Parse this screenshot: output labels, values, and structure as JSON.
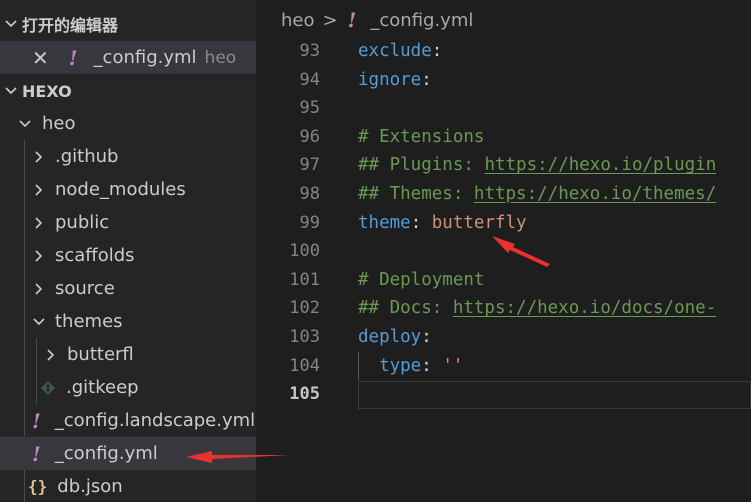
{
  "sidebar": {
    "open_editors_title": "打开的编辑器",
    "open_editor_item": {
      "name": "_config.yml",
      "description": "heo",
      "close_glyph": "✕",
      "file_glyph": "!"
    },
    "project_title": "HEXO",
    "tree": [
      {
        "label": "heo",
        "type": "folder-open"
      },
      {
        "label": ".github",
        "type": "folder"
      },
      {
        "label": "node_modules",
        "type": "folder"
      },
      {
        "label": "public",
        "type": "folder"
      },
      {
        "label": "scaffolds",
        "type": "folder"
      },
      {
        "label": "source",
        "type": "folder"
      },
      {
        "label": "themes",
        "type": "folder-open"
      },
      {
        "label": "butterfl",
        "type": "folder"
      },
      {
        "label": ".gitkeep",
        "type": "git-file"
      },
      {
        "label": "_config.landscape.yml",
        "type": "yaml-file",
        "glyph": "!"
      },
      {
        "label": "_config.yml",
        "type": "yaml-file",
        "glyph": "!",
        "selected": true
      },
      {
        "label": "db.json",
        "type": "json-file",
        "glyph": "{}"
      }
    ]
  },
  "editor": {
    "breadcrumb": {
      "folder": "heo",
      "separator": ">",
      "file": "_config.yml",
      "file_glyph": "!"
    },
    "line_numbers": [
      "93",
      "94",
      "95",
      "96",
      "97",
      "98",
      "99",
      "100",
      "101",
      "102",
      "103",
      "104",
      "105"
    ],
    "lines": {
      "l93_key": "exclude",
      "l93_colon": ":",
      "l94_key": "ignore",
      "l94_colon": ":",
      "l96_comment": "# Extensions",
      "l97_comment": "## Plugins: ",
      "l97_url": "https://hexo.io/plugin",
      "l98_comment": "## Themes: ",
      "l98_url": "https://hexo.io/themes/",
      "l99_key": "theme",
      "l99_colon": ": ",
      "l99_value": "butterfly",
      "l101_comment": "# Deployment",
      "l102_comment": "## Docs: ",
      "l102_url": "https://hexo.io/docs/one-",
      "l103_key": "deploy",
      "l103_colon": ":",
      "l104_key": "type",
      "l104_colon": ": ",
      "l104_value": "''"
    },
    "active_line": "105"
  },
  "colors": {
    "annotation_arrow": "#e8322b",
    "keyword": "#569cd6",
    "comment": "#6a9955",
    "string": "#ce9178",
    "yaml_icon": "#c586c0",
    "json_icon": "#e2c08d"
  }
}
